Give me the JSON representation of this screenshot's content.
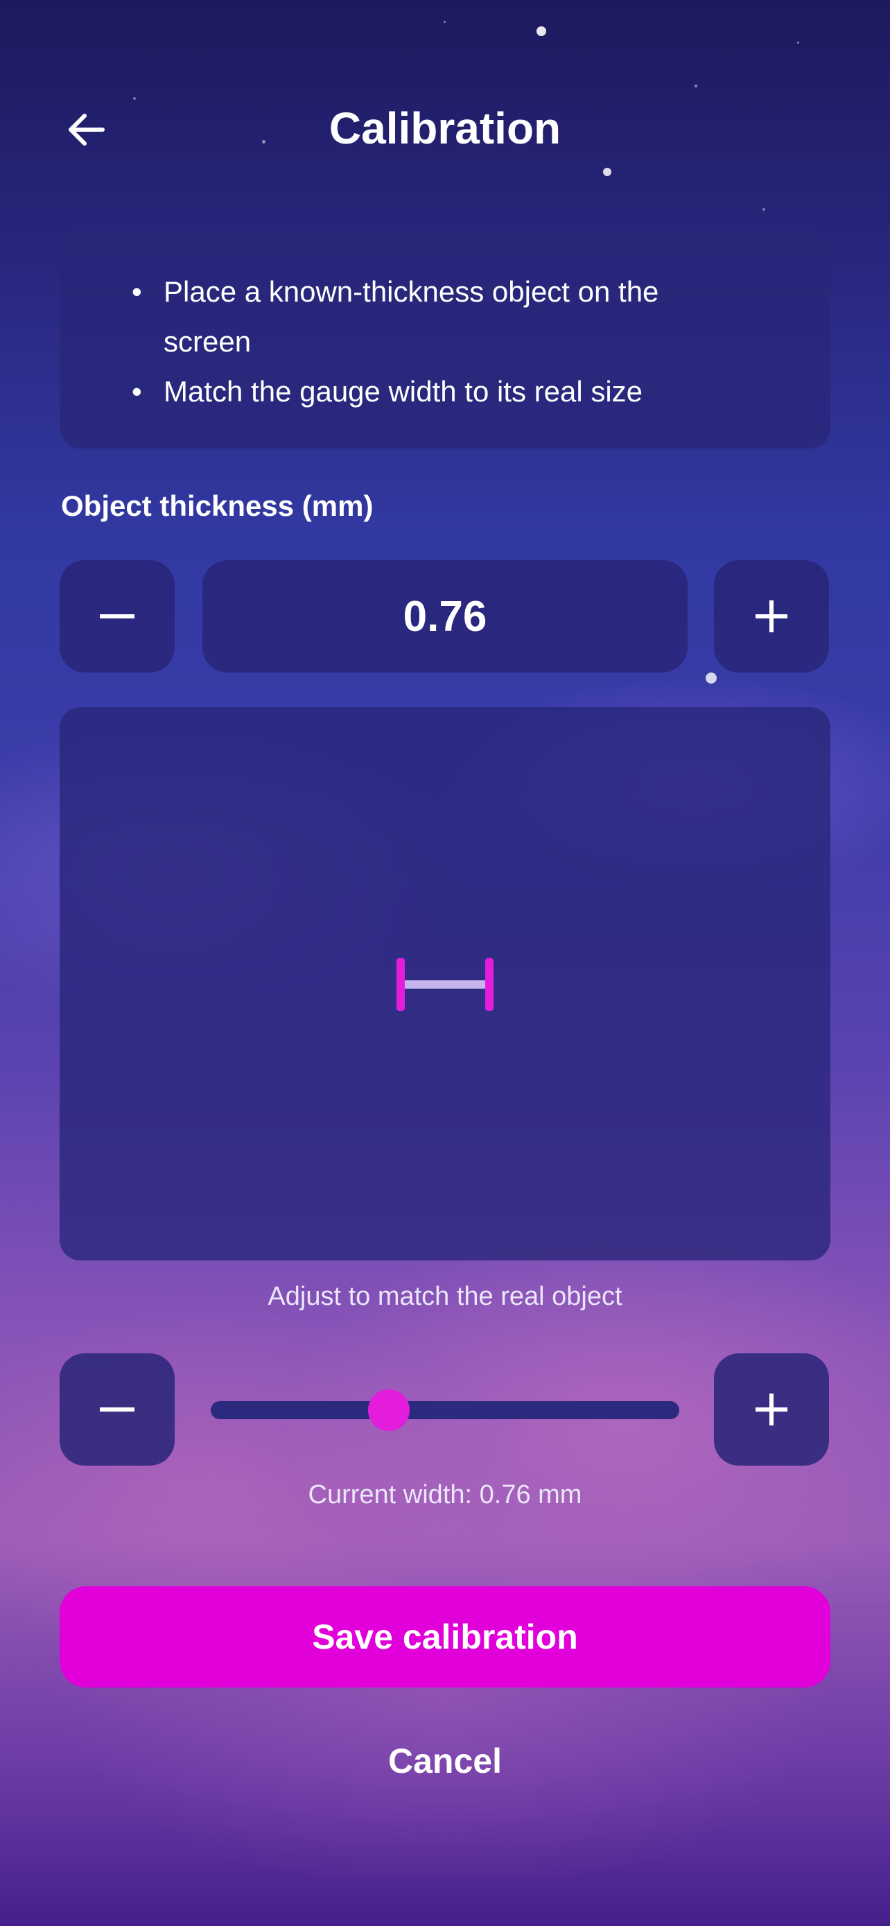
{
  "header": {
    "title": "Calibration",
    "back_icon": "arrow-left-icon"
  },
  "instructions": {
    "items": [
      "Place a known-thickness object on the screen",
      "Match the gauge width to its real size"
    ]
  },
  "thickness": {
    "label": "Object thickness (mm)",
    "value": "0.76",
    "decrement_label": "−",
    "increment_label": "+"
  },
  "gauge": {
    "hint": "Adjust to match the real object",
    "slider_fraction": 0.38,
    "decrement_label": "−",
    "increment_label": "+",
    "current_width": "Current width: 0.76 mm"
  },
  "actions": {
    "save_label": "Save calibration",
    "cancel_label": "Cancel"
  },
  "colors": {
    "accent": "#e100d9",
    "card": "#28267a",
    "track": "#2b2a7e",
    "gauge_line": "#c9b5ee"
  }
}
